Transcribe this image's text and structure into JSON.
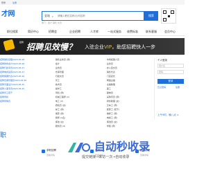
{
  "topbar": {
    "login": "登录",
    "register": "注册"
  },
  "logo": "才网",
  "search": {
    "city": "全站",
    "placeholder": "请输入职位名称/公司名称",
    "button": "搜索",
    "hint": "热门：会计 销售 文员"
  },
  "nav": [
    "职位搜索",
    "简历中心",
    "招聘会",
    "企业招聘",
    "人才库",
    "一站式服务",
    "收费标准",
    "联系客服",
    "会员中心"
  ],
  "banner": {
    "logo_mini": "招聘",
    "headline": "招聘见效慢？",
    "sub_prefix": "入驻企业",
    "sub_highlight": "VIP",
    "sub_suffix": "，助您招聘快人一步"
  },
  "left_list": [
    "招聘销售经理2023.05.28",
    "招聘财务会计2023.05.28",
    "招聘行政专员2023.05.27",
    "招聘电商运营2023.05.27",
    "招聘客服代表2023.05.26",
    "招聘仓库管理员2023.05.26",
    "招聘平面设计2023.05.25",
    "招聘人事专员2023.05.25",
    "招聘普工若干",
    "招聘司机",
    "招聘导购员"
  ],
  "categories_col1": [
    "· 销售业务员 (男)",
    "· 会计",
    "· 业务员",
    "· 仓库管理",
    "· 行政文员",
    "· 普工",
    "· 技术员",
    "· 操作工",
    "· 司机 (男)",
    "· 机械工程师 (1)",
    "· 电工 (2)",
    "· 质检员 (女)",
    "· 焊工 (男)",
    "· 保安 (男)",
    "· 厨师 (1名)",
    "· 保洁 (女)",
    "· 服务员 (4)"
  ],
  "categories_col2": [
    "· 市场拓展人员",
    "· 业务员",
    "· 办公室文员",
    "· 销售代表",
    "· 门店店长",
    "· 网络主播",
    "· 主播助理",
    "· 美工",
    "· 跟单员",
    "· 采购专员 (男)",
    "· 财务助理 (女)",
    "· 叉车工 (男)",
    "· 装卸工 (若干)",
    "· 维修工 (男)",
    "· 电焊工 (男)",
    "· 保洁员 (女)",
    "· 学徒 (男)"
  ],
  "right_panel": {
    "title": "个人登录",
    "username_placeholder": "用户名",
    "password_placeholder": "密码",
    "login_button": "登录",
    "forgot": "忘记密码",
    "register": "注册",
    "footer": "上午9时，晚八点 >"
  },
  "section_title": "职",
  "jobs": [
    {
      "name": "求职招聘",
      "tag": "查看详情"
    },
    {
      "name": "普通工人",
      "tag": "查看详情"
    },
    {
      "name": "招聘助理",
      "tag": "查看详情"
    }
  ],
  "watermark": {
    "title": "自动秒收录",
    "subtitle": "提交链接→来访一次→自动收录"
  }
}
